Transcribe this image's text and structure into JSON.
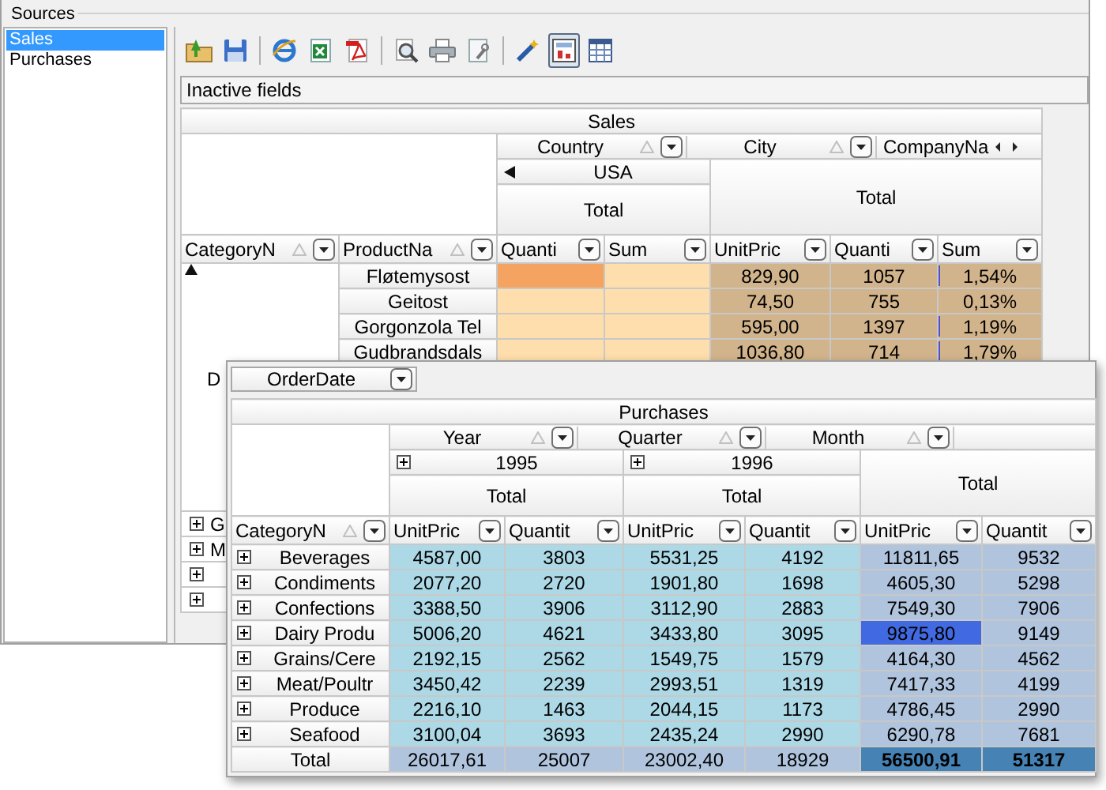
{
  "sources": {
    "title": "Sources",
    "items": [
      {
        "label": "Sales",
        "selected": true
      },
      {
        "label": "Purchases",
        "selected": false
      }
    ]
  },
  "toolbar": [
    {
      "kind": "open",
      "on": false
    },
    {
      "kind": "save",
      "on": false
    },
    {
      "kind": "separator"
    },
    {
      "kind": "browser",
      "on": false
    },
    {
      "kind": "excel",
      "on": false
    },
    {
      "kind": "pdf",
      "on": false
    },
    {
      "kind": "separator"
    },
    {
      "kind": "preview",
      "on": false
    },
    {
      "kind": "print",
      "on": false
    },
    {
      "kind": "page",
      "on": false
    },
    {
      "kind": "separator"
    },
    {
      "kind": "wand",
      "on": false
    },
    {
      "kind": "chart",
      "on": true
    },
    {
      "kind": "grid",
      "on": false
    }
  ],
  "inactive_fields": "Inactive fields",
  "sales_grid": {
    "title": "Sales",
    "column_fields": [
      {
        "label": "Country",
        "sorted": true
      },
      {
        "label": "City",
        "sorted": true
      },
      {
        "label": "CompanyNa"
      }
    ],
    "country_value": "USA",
    "subtotal": "Total",
    "grand_total": "Total",
    "row_fields": [
      {
        "label": "CategoryN",
        "sorted": true
      },
      {
        "label": "ProductNa",
        "sorted": true
      }
    ],
    "measures": [
      {
        "label": "Quanti"
      },
      {
        "label": "Sum"
      },
      {
        "label": "UnitPric"
      },
      {
        "label": "Quanti"
      },
      {
        "label": "Sum"
      }
    ],
    "expanded_category": {
      "label": "D",
      "expanded": true
    },
    "rows": [
      {
        "product": "Fløtemysost",
        "usa_highlight": true,
        "unit_price": "829,90",
        "quantity": "1057",
        "share": "1,54%",
        "level": 0.0154
      },
      {
        "product": "Geitost",
        "usa_highlight": false,
        "unit_price": "74,50",
        "quantity": "755",
        "share": "0,13%"
      },
      {
        "product": "Gorgonzola Tel",
        "usa_highlight": false,
        "unit_price": "595,00",
        "quantity": "1397",
        "share": "1,19%",
        "level": 0.0119
      },
      {
        "product": "Gudbrandsdals",
        "usa_highlight": false,
        "unit_price": "1036,80",
        "quantity": "714",
        "share": "1,79%",
        "level": 0.0179
      }
    ],
    "collapsed_categories": [
      {
        "label": "G",
        "expanded": false
      },
      {
        "label": "M",
        "expanded": false
      },
      {
        "expanded": false
      },
      {
        "expanded": false
      }
    ]
  },
  "purchases_window": {
    "filter_field": "OrderDate",
    "title": "Purchases",
    "column_fields": [
      {
        "label": "Year",
        "sorted": true
      },
      {
        "label": "Quarter",
        "sorted": true
      },
      {
        "label": "Month",
        "sorted": true
      }
    ],
    "years": [
      {
        "label": "1995",
        "expanded": false,
        "subtotal": "Total"
      },
      {
        "label": "1996",
        "expanded": false,
        "subtotal": "Total"
      }
    ],
    "grand_total": "Total",
    "row_field": {
      "label": "CategoryN",
      "sorted": true
    },
    "measures": [
      {
        "label": "UnitPric",
        "kind": "year"
      },
      {
        "label": "Quantit",
        "kind": "year"
      },
      {
        "label": "UnitPric",
        "kind": "year"
      },
      {
        "label": "Quantit",
        "kind": "year"
      },
      {
        "label": "UnitPric",
        "kind": "total"
      },
      {
        "label": "Quantit",
        "kind": "total"
      }
    ],
    "rows": [
      {
        "category": "Beverages",
        "expanded": false,
        "cells": [
          {
            "value": "4587,00",
            "highlighted": false
          },
          {
            "value": "3803",
            "highlighted": false
          },
          {
            "value": "5531,25",
            "highlighted": false
          },
          {
            "value": "4192",
            "highlighted": false
          },
          {
            "value": "11811,65",
            "highlighted": false
          },
          {
            "value": "9532",
            "highlighted": false
          }
        ]
      },
      {
        "category": "Condiments",
        "expanded": false,
        "cells": [
          {
            "value": "2077,20",
            "highlighted": false
          },
          {
            "value": "2720",
            "highlighted": false
          },
          {
            "value": "1901,80",
            "highlighted": false
          },
          {
            "value": "1698",
            "highlighted": false
          },
          {
            "value": "4605,30",
            "highlighted": false
          },
          {
            "value": "5298",
            "highlighted": false
          }
        ]
      },
      {
        "category": "Confections",
        "expanded": false,
        "cells": [
          {
            "value": "3388,50",
            "highlighted": false
          },
          {
            "value": "3906",
            "highlighted": false
          },
          {
            "value": "3112,90",
            "highlighted": false
          },
          {
            "value": "2883",
            "highlighted": false
          },
          {
            "value": "7549,30",
            "highlighted": false
          },
          {
            "value": "7906",
            "highlighted": false
          }
        ]
      },
      {
        "category": "Dairy Produ",
        "expanded": false,
        "cells": [
          {
            "value": "5006,20",
            "highlighted": false
          },
          {
            "value": "4621",
            "highlighted": false
          },
          {
            "value": "3433,80",
            "highlighted": false
          },
          {
            "value": "3095",
            "highlighted": false
          },
          {
            "value": "9875,80",
            "highlighted": true
          },
          {
            "value": "9149",
            "highlighted": false
          }
        ]
      },
      {
        "category": "Grains/Cere",
        "expanded": false,
        "cells": [
          {
            "value": "2192,15",
            "highlighted": false
          },
          {
            "value": "2562",
            "highlighted": false
          },
          {
            "value": "1549,75",
            "highlighted": false
          },
          {
            "value": "1579",
            "highlighted": false
          },
          {
            "value": "4164,30",
            "highlighted": false
          },
          {
            "value": "4562",
            "highlighted": false
          }
        ]
      },
      {
        "category": "Meat/Poultr",
        "expanded": false,
        "cells": [
          {
            "value": "3450,42",
            "highlighted": false
          },
          {
            "value": "2239",
            "highlighted": false
          },
          {
            "value": "2993,51",
            "highlighted": false
          },
          {
            "value": "1319",
            "highlighted": false
          },
          {
            "value": "7417,33",
            "highlighted": false
          },
          {
            "value": "4199",
            "highlighted": false
          }
        ]
      },
      {
        "category": "Produce",
        "expanded": false,
        "cells": [
          {
            "value": "2216,10",
            "highlighted": false
          },
          {
            "value": "1463",
            "highlighted": false
          },
          {
            "value": "2044,15",
            "highlighted": false
          },
          {
            "value": "1173",
            "highlighted": false
          },
          {
            "value": "4786,45",
            "highlighted": false
          },
          {
            "value": "2990",
            "highlighted": false
          }
        ]
      },
      {
        "category": "Seafood",
        "expanded": false,
        "cells": [
          {
            "value": "3100,04",
            "highlighted": false
          },
          {
            "value": "3693",
            "highlighted": false
          },
          {
            "value": "2435,24",
            "highlighted": false
          },
          {
            "value": "2990",
            "highlighted": false
          },
          {
            "value": "6290,78",
            "highlighted": false
          },
          {
            "value": "7681",
            "highlighted": false
          }
        ]
      }
    ],
    "total_row": {
      "label": "Total",
      "cells": [
        "26017,61",
        "25007",
        "23002,40",
        "18929",
        "56500,91",
        "51317"
      ]
    }
  }
}
